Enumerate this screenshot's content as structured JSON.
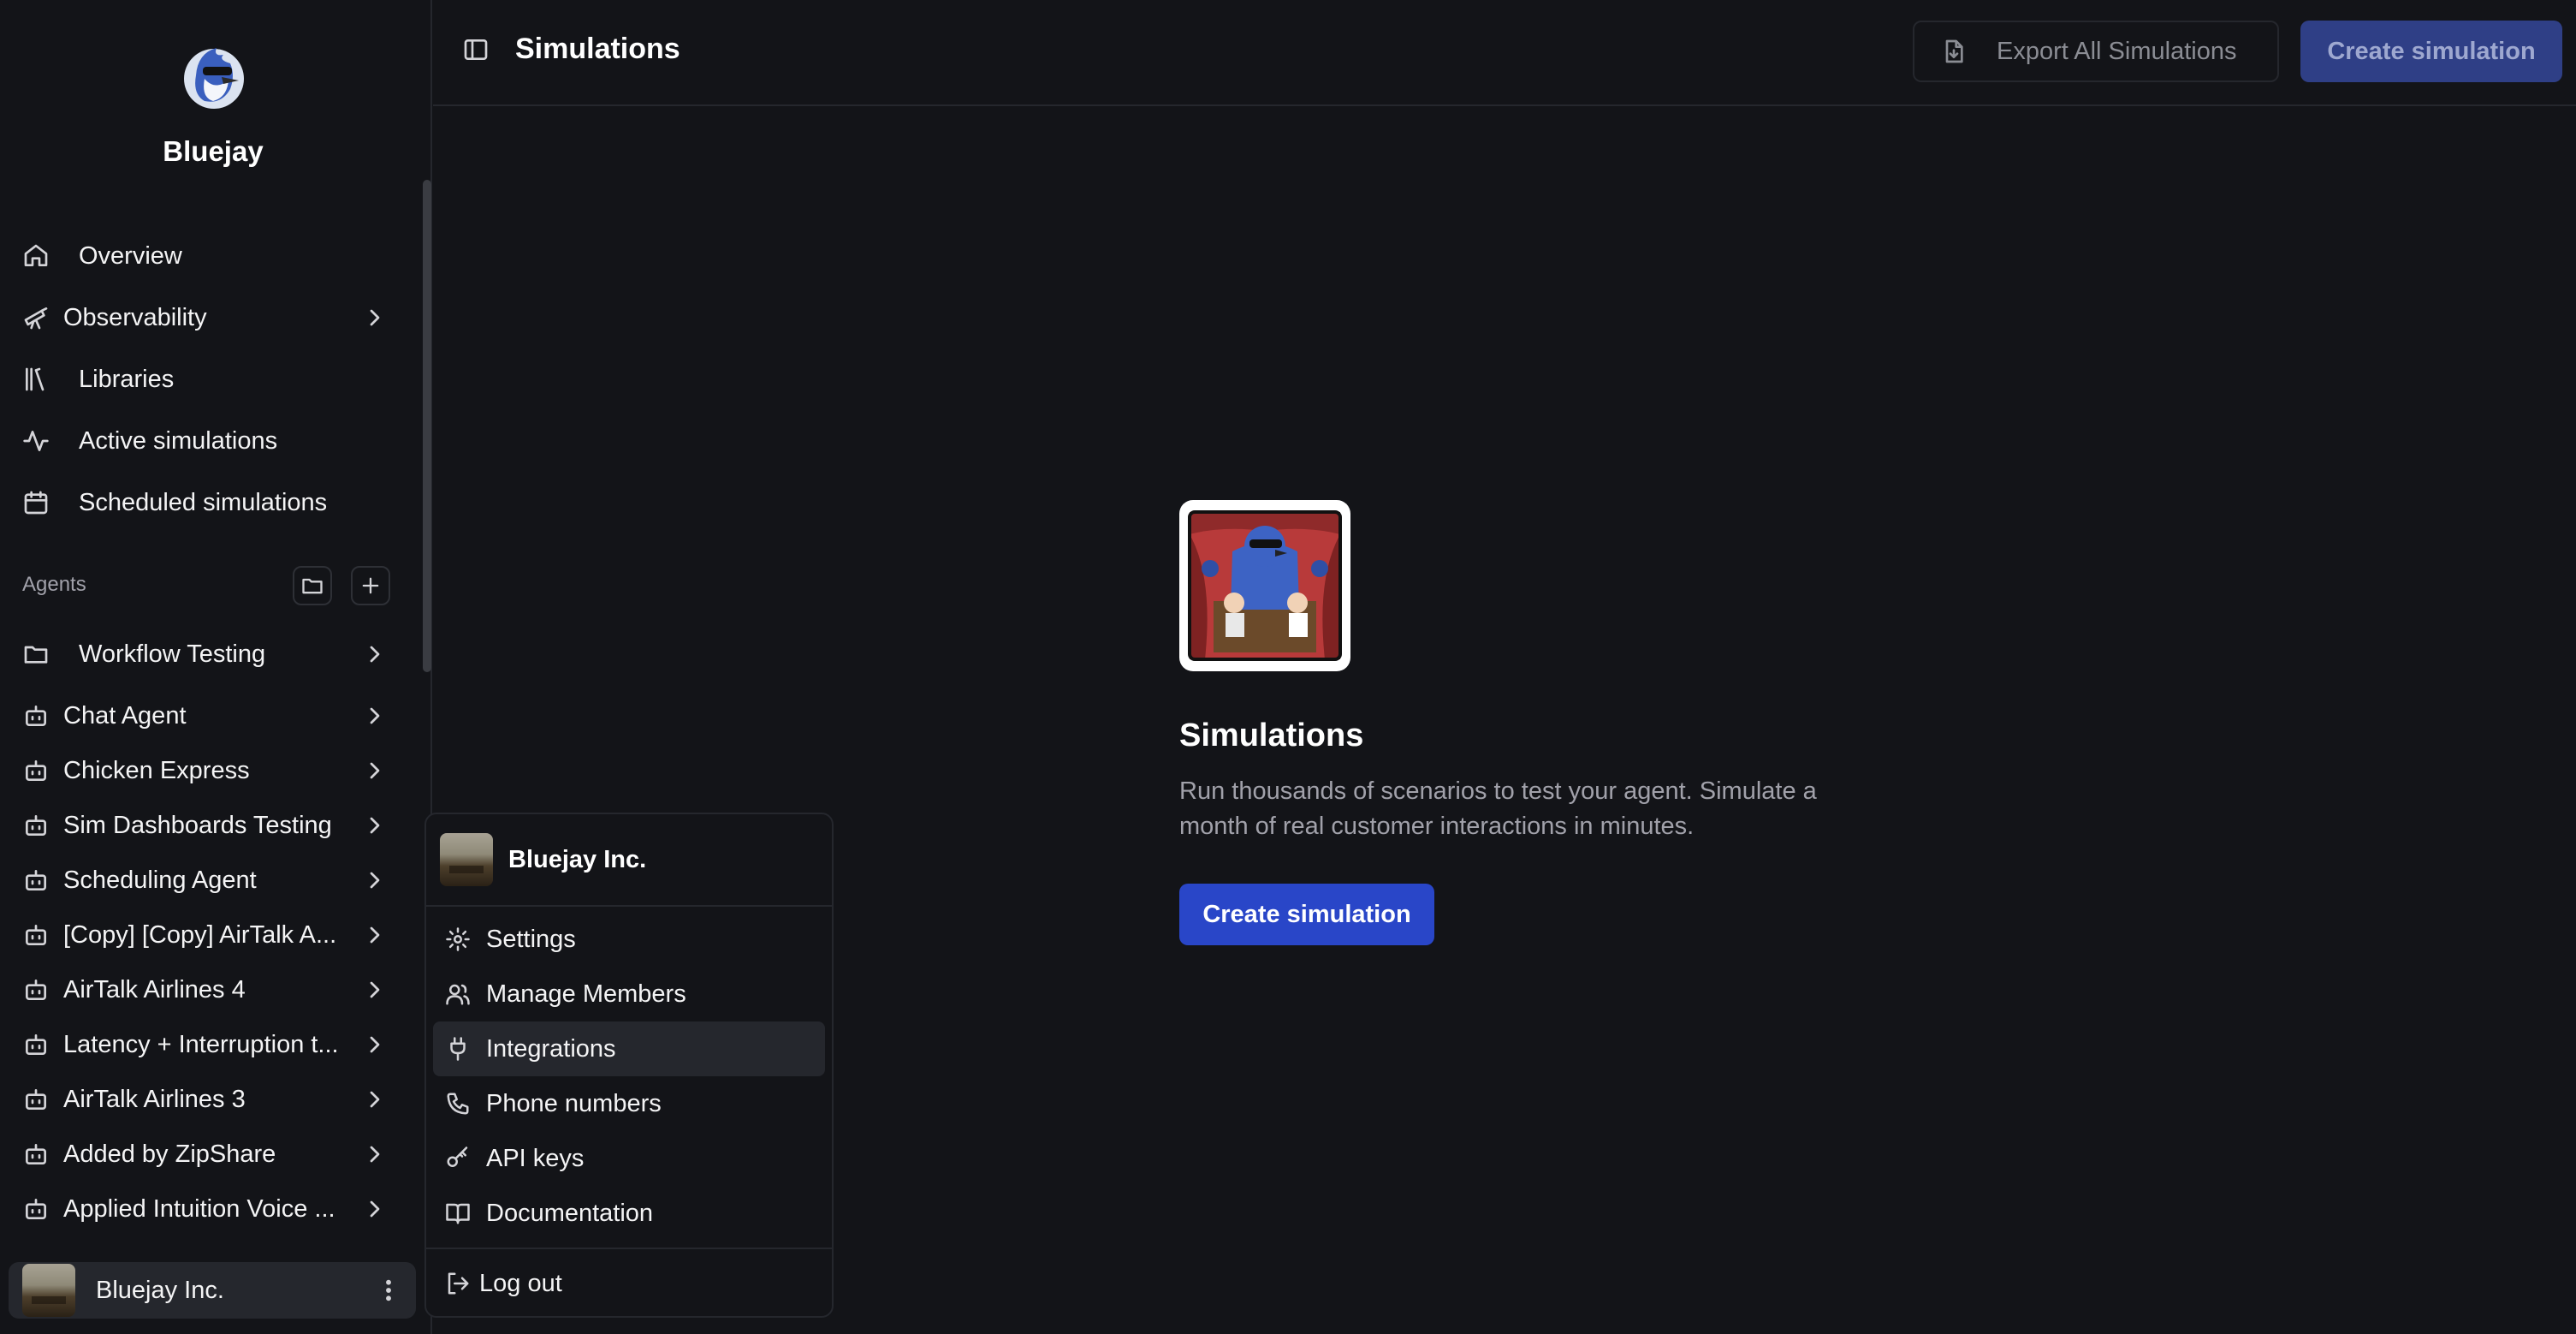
{
  "brand": {
    "name": "Bluejay"
  },
  "sidebar": {
    "nav": [
      {
        "label": "Overview",
        "icon": "home-icon"
      },
      {
        "label": "Observability",
        "icon": "telescope-icon",
        "has_chevron": true
      },
      {
        "label": "Libraries",
        "icon": "library-icon"
      },
      {
        "label": "Active simulations",
        "icon": "activity-icon"
      },
      {
        "label": "Scheduled simulations",
        "icon": "calendar-icon"
      }
    ],
    "agents_label": "Agents",
    "agents": [
      {
        "label": "Workflow Testing",
        "icon": "folder-icon"
      },
      {
        "label": "Chat Agent",
        "icon": "bot-icon"
      },
      {
        "label": "Chicken Express",
        "icon": "bot-icon"
      },
      {
        "label": "Sim Dashboards Testing",
        "icon": "bot-icon"
      },
      {
        "label": "Scheduling Agent",
        "icon": "bot-icon"
      },
      {
        "label": "[Copy] [Copy] AirTalk A...",
        "icon": "bot-icon"
      },
      {
        "label": "AirTalk Airlines 4",
        "icon": "bot-icon"
      },
      {
        "label": "Latency + Interruption t...",
        "icon": "bot-icon"
      },
      {
        "label": "AirTalk Airlines 3",
        "icon": "bot-icon"
      },
      {
        "label": "Added by ZipShare",
        "icon": "bot-icon"
      },
      {
        "label": "Applied Intuition Voice ...",
        "icon": "bot-icon"
      }
    ],
    "footer_user": "Bluejay Inc."
  },
  "header": {
    "title": "Simulations",
    "export_label": "Export All Simulations",
    "create_label": "Create simulation"
  },
  "empty_state": {
    "title": "Simulations",
    "description": "Run thousands of scenarios to test your agent. Simulate a month of real customer interactions in minutes.",
    "button_label": "Create simulation"
  },
  "account_menu": {
    "org_name": "Bluejay Inc.",
    "items": [
      {
        "label": "Settings",
        "icon": "gear-icon"
      },
      {
        "label": "Manage Members",
        "icon": "users-icon"
      },
      {
        "label": "Integrations",
        "icon": "plug-icon",
        "active": true
      },
      {
        "label": "Phone numbers",
        "icon": "phone-icon"
      },
      {
        "label": "API keys",
        "icon": "key-icon"
      },
      {
        "label": "Documentation",
        "icon": "book-icon"
      }
    ],
    "logout_label": "Log out"
  },
  "colors": {
    "background": "#131418",
    "primary": "#2946c8",
    "primary_muted": "#2f3f86",
    "border": "#25272d",
    "muted_text": "#a1a1aa"
  }
}
